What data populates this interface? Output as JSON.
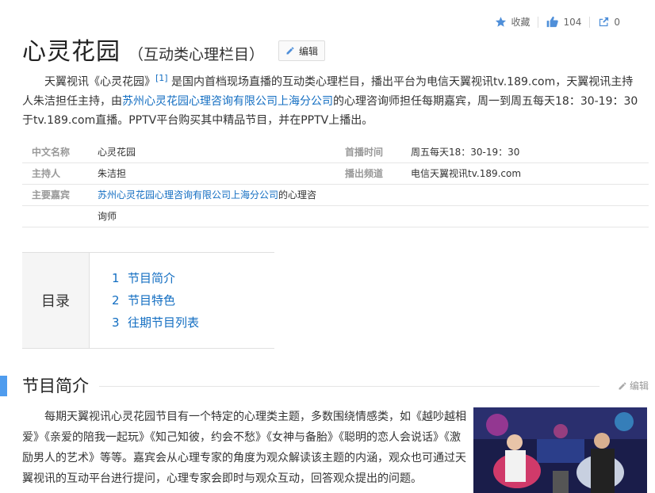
{
  "toolbar": {
    "collect_label": "收藏",
    "like_count": "104",
    "share_count": "0"
  },
  "header": {
    "title": "心灵花园",
    "subtitle": "（互动类心理栏目）",
    "edit_label": "编辑"
  },
  "summary": {
    "part1": "天翼视讯《心灵花园》",
    "ref": "[1]",
    "part2": " 是国内首档现场直播的互动类心理栏目，播出平台为电信天翼视讯tv.189.com，天翼视讯主持人朱洁担任主持，由",
    "link": "苏州心灵花园心理咨询有限公司上海分公司",
    "part3": "的心理咨询师担任每期嘉宾，周一到周五每天18：30-19：30于tv.189.com直播。PPTV平台购买其中精品节目，并在PPTV上播出。"
  },
  "infobox": {
    "left": [
      {
        "name": "中文名称",
        "value": "心灵花园"
      },
      {
        "name": "主持人",
        "value": "朱洁担"
      },
      {
        "name": "主要嘉宾",
        "link": "苏州心灵花园心理咨询有限公司上海分公司",
        "value": "的心理咨",
        "cont": "询师"
      }
    ],
    "right": [
      {
        "name": "首播时间",
        "value": "周五每天18：30-19：30"
      },
      {
        "name": "播出频道",
        "value": "电信天翼视讯tv.189.com"
      }
    ]
  },
  "toc": {
    "label": "目录",
    "items": [
      {
        "num": "1",
        "label": "节目简介"
      },
      {
        "num": "2",
        "label": "节目特色"
      },
      {
        "num": "3",
        "label": "往期节目列表"
      }
    ]
  },
  "section": {
    "title": "节目简介",
    "edit_label": "编辑",
    "text": "每期天翼视讯心灵花园节目有一个特定的心理类主题，多数围绕情感类，如《越吵越相爱》《亲爱的陪我一起玩》《知己知彼，约会不愁》《女神与备胎》《聪明的恋人会说话》《激励男人的艺术》等等。嘉宾会从心理专家的角度为观众解读该主题的内涵，观众也可通过天翼视讯的互动平台进行提问，心理专家会即时与观众互动，回答观众提出的问题。"
  },
  "colors": {
    "link": "#136ec2",
    "accent_bar": "#4f9cee"
  }
}
